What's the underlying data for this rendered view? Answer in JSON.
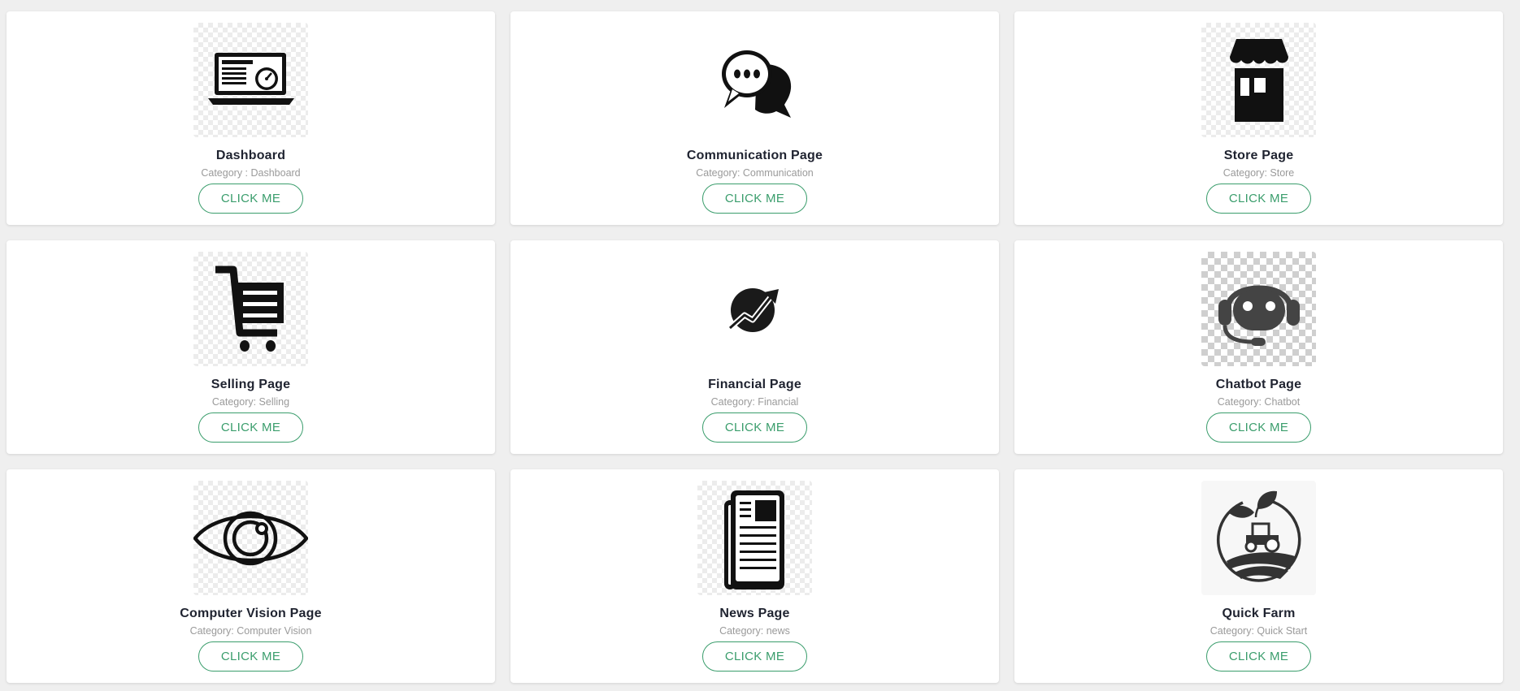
{
  "cards": [
    {
      "title": "Dashboard",
      "category": "Category : Dashboard",
      "button": "CLICK ME",
      "icon": "dashboard-laptop-icon"
    },
    {
      "title": "Communication Page",
      "category": "Category: Communication",
      "button": "CLICK ME",
      "icon": "chat-bubbles-icon"
    },
    {
      "title": "Store Page",
      "category": "Category: Store",
      "button": "CLICK ME",
      "icon": "storefront-icon"
    },
    {
      "title": "Selling Page",
      "category": "Category: Selling",
      "button": "CLICK ME",
      "icon": "shopping-cart-icon"
    },
    {
      "title": "Financial Page",
      "category": "Category: Financial",
      "button": "CLICK ME",
      "icon": "growth-chart-icon"
    },
    {
      "title": "Chatbot Page",
      "category": "Category: Chatbot",
      "button": "CLICK ME",
      "icon": "robot-headset-icon"
    },
    {
      "title": "Computer Vision Page",
      "category": "Category: Computer Vision",
      "button": "CLICK ME",
      "icon": "eye-icon"
    },
    {
      "title": "News Page",
      "category": "Category: news",
      "button": "CLICK ME",
      "icon": "newspaper-icon"
    },
    {
      "title": "Quick Farm",
      "category": "Category: Quick Start",
      "button": "CLICK ME",
      "icon": "farm-tractor-icon"
    }
  ],
  "colors": {
    "accent": "#3a9d6c",
    "title": "#1f2330",
    "muted": "#9a9a9a",
    "background": "#efefef"
  }
}
